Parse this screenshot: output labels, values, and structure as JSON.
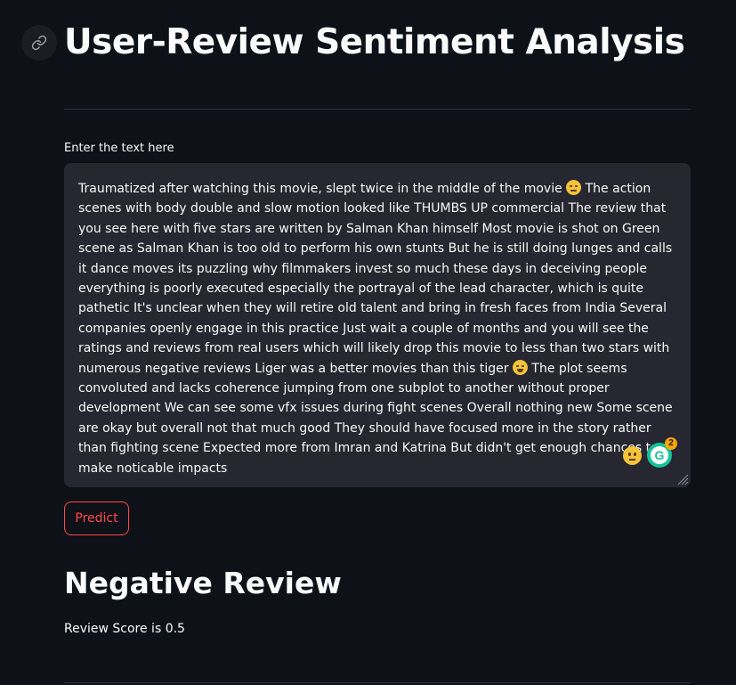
{
  "page": {
    "title": "User-Review Sentiment Analysis"
  },
  "input": {
    "label": "Enter the text here",
    "value_part1": "Traumatized after watching this movie, slept twice in the middle of the movie",
    "value_part2": "The action scenes with body double and slow motion looked like THUMBS UP commercial The review that you see here with five stars are written by Salman Khan himself Most movie is shot on Green scene as Salman Khan is too old to perform his own stunts But he is still doing lunges and calls it dance moves its puzzling why filmmakers invest so much these days in deceiving people everything is poorly executed especially the portrayal of the lead character, which is quite pathetic It's unclear when they will retire old talent and bring in fresh faces from India Several companies openly engage in this practice Just wait a couple of months and you will see the ratings and reviews from real users which will likely drop this movie to less than two stars with numerous negative reviews Liger was a better movies than this tiger",
    "value_part3": "The plot seems convoluted and lacks coherence jumping from one subplot to another without proper development We can see some vfx issues during fight scenes Overall nothing new Some scene are okay but overall not that much good They should have focused more in the story rather than fighting scene Expected more from Imran and Katrina But didn't get enough chances to make noticable impacts",
    "grammarly_count": "2",
    "grammarly_glyph": "G"
  },
  "actions": {
    "predict_label": "Predict"
  },
  "result": {
    "heading": "Negative Review",
    "score_text": "Review Score is 0.5"
  },
  "colors": {
    "background": "#0e1117",
    "textarea_bg": "#262730",
    "accent": "#ff4b4b",
    "grammarly_green": "#15c39a"
  },
  "icons": {
    "anchor": "link-icon",
    "emoji_1": "disappointed-face-icon",
    "emoji_2": "rolling-on-floor-laughing-icon",
    "extension_emoji": "slightly-frowning-face-icon",
    "grammarly": "grammarly-icon",
    "resize": "resize-handle-icon"
  }
}
